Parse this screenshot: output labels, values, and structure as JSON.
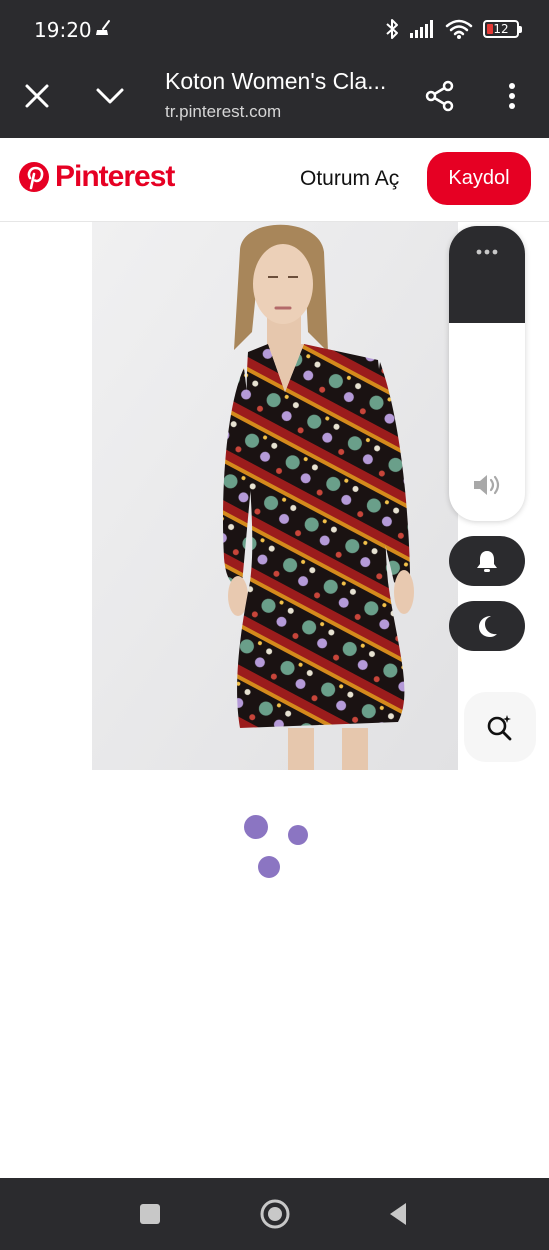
{
  "status_bar": {
    "time": "19:20",
    "battery": "12",
    "icons": [
      "broom-icon",
      "bluetooth-icon",
      "signal-icon",
      "wifi-icon",
      "battery-icon"
    ],
    "battery_color": "#e53935"
  },
  "browser": {
    "title": "Koton Women's Cla...",
    "url": "tr.pinterest.com",
    "icons": [
      "close-icon",
      "chevron-down-icon",
      "share-icon",
      "more-vert-icon"
    ]
  },
  "pinterest": {
    "logo_text": "Pinterest",
    "login_label": "Oturum Aç",
    "signup_label": "Kaydol",
    "brand_color": "#e60023"
  },
  "volume_overlay": {
    "level": 0.33,
    "icons": [
      "more-dots-icon",
      "speaker-icon",
      "bell-icon",
      "moon-icon",
      "visual-search-icon"
    ]
  },
  "loading": {
    "dot_color": "#8b75c2"
  },
  "nav_bar": {
    "icons": [
      "recents-square-icon",
      "home-circle-icon",
      "back-triangle-icon"
    ]
  }
}
